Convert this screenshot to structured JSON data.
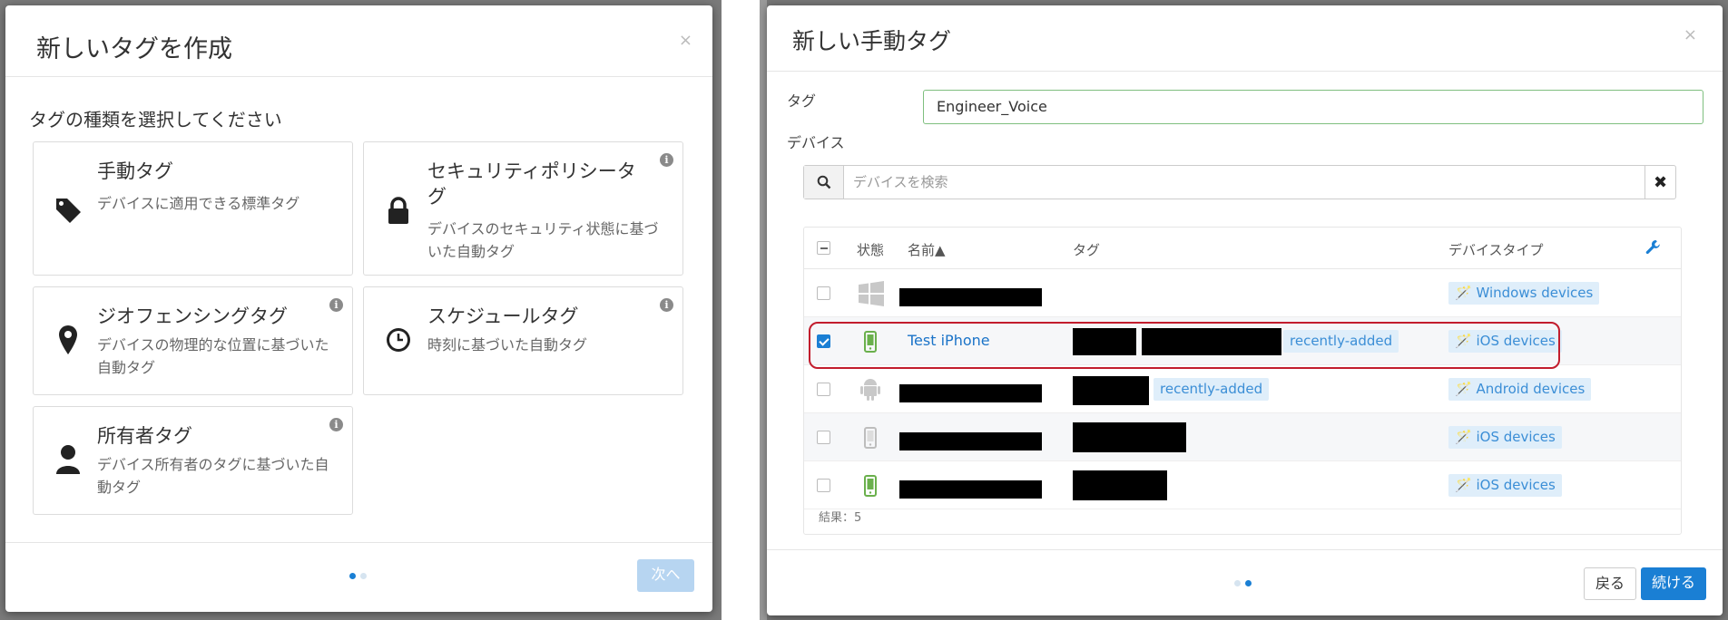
{
  "left_modal": {
    "title": "新しいタグを作成",
    "close": "×",
    "prompt": "タグの種類を選択してください",
    "cards": [
      {
        "title": "手動タグ",
        "desc": "デバイスに適用できる標準タグ",
        "icon": "tag-icon",
        "info": false
      },
      {
        "title": "セキュリティポリシータグ",
        "desc": "デバイスのセキュリティ状態に基づいた自動タグ",
        "icon": "lock-icon",
        "info": true
      },
      {
        "title": "ジオフェンシングタグ",
        "desc": "デバイスの物理的な位置に基づいた自動タグ",
        "icon": "map-marker-icon",
        "info": true
      },
      {
        "title": "スケジュールタグ",
        "desc": "時刻に基づいた自動タグ",
        "icon": "clock-icon",
        "info": true
      },
      {
        "title": "所有者タグ",
        "desc": "デバイス所有者のタグに基づいた自動タグ",
        "icon": "user-icon",
        "info": true
      }
    ],
    "info_glyph": "i",
    "next_label": "次へ",
    "page_indicator": {
      "current": 1,
      "total": 2
    }
  },
  "right_modal": {
    "title": "新しい手動タグ",
    "close": "×",
    "tag_label": "タグ",
    "tag_value": "Engineer_Voice",
    "device_label": "デバイス",
    "search_placeholder": "デバイスを検索",
    "clear_glyph": "✖",
    "columns": {
      "status": "状態",
      "name": "名前▲",
      "tags": "タグ",
      "type": "デバイスタイプ"
    },
    "rows": [
      {
        "checked": false,
        "os": "windows-icon",
        "name": "",
        "tags": [],
        "type": "Windows devices"
      },
      {
        "checked": true,
        "os": "iphone-icon",
        "name": "Test iPhone",
        "tags": [
          "recently-added"
        ],
        "type": "iOS devices"
      },
      {
        "checked": false,
        "os": "android-icon",
        "name": "",
        "tags": [
          "recently-added"
        ],
        "type": "Android devices"
      },
      {
        "checked": false,
        "os": "iphone-icon",
        "name": "",
        "tags": [],
        "type": "iOS devices"
      },
      {
        "checked": false,
        "os": "iphone-icon",
        "name": "",
        "tags": [],
        "type": "iOS devices"
      }
    ],
    "results": "結果：5",
    "back_label": "戻る",
    "continue_label": "続ける",
    "page_indicator": {
      "current": 2,
      "total": 2
    }
  },
  "colors": {
    "accent": "#1a7fd4",
    "ios_green": "#6ab04c",
    "highlight_red": "#c21d2d"
  }
}
